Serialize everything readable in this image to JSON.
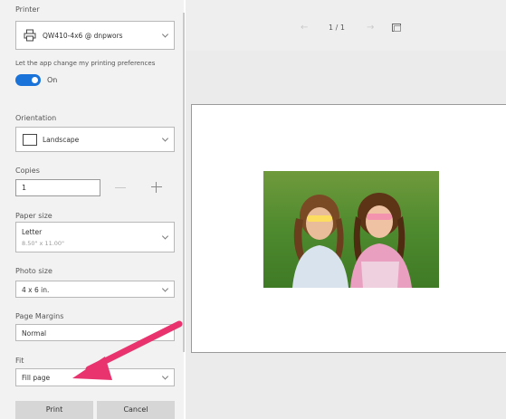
{
  "settings": {
    "printer_label": "Printer",
    "printer_value": "QW410-4x6 @ dnpwors",
    "prefs_label": "Let the app change my printing preferences",
    "toggle_state": "On",
    "orientation_label": "Orientation",
    "orientation_value": "Landscape",
    "copies_label": "Copies",
    "copies_value": "1",
    "paper_size_label": "Paper size",
    "paper_size_value": "Letter",
    "paper_size_dims": "8.50\" x 11.00\"",
    "photo_size_label": "Photo size",
    "photo_size_value": "4 x 6 in.",
    "margins_label": "Page Margins",
    "margins_value": "Normal",
    "fit_label": "Fit",
    "fit_value": "Fill page"
  },
  "buttons": {
    "print": "Print",
    "cancel": "Cancel"
  },
  "preview": {
    "page_indicator": "1 / 1",
    "prev_icon": "arrow-left-icon",
    "next_icon": "arrow-right-icon",
    "fit_icon": "fit-page-icon"
  },
  "annotation": {
    "arrow_color": "#e8336e"
  },
  "colors": {
    "toggle_on": "#1a73d8",
    "panel_bg": "#f2f2f2",
    "preview_bg": "#ebebeb"
  }
}
